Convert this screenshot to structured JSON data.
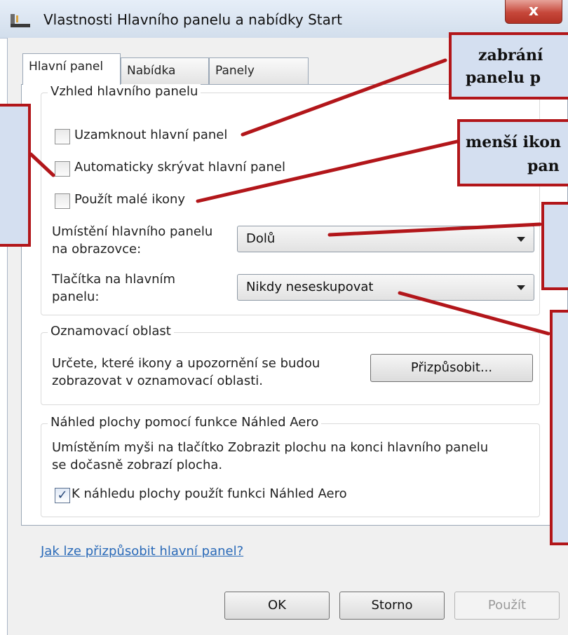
{
  "window": {
    "title": "Vlastnosti Hlavního panelu a nabídky Start",
    "close_label": "x"
  },
  "tabs": [
    {
      "label": "Hlavní panel"
    },
    {
      "label": "Nabídka Start"
    },
    {
      "label": "Panely nástrojů"
    }
  ],
  "appearance": {
    "legend": "Vzhled hlavního panelu",
    "lock_label": "Uzamknout hlavní panel",
    "lock_checked": false,
    "autohide_label": "Automaticky skrývat hlavní panel",
    "autohide_checked": false,
    "small_icons_label": "Použít malé ikony",
    "small_icons_checked": false,
    "position_label_1": "Umístění hlavního panelu",
    "position_label_2": "na obrazovce:",
    "position_value": "Dolů",
    "buttons_label_1": "Tlačítka na hlavním",
    "buttons_label_2": "panelu:",
    "buttons_value": "Nikdy neseskupovat"
  },
  "notification": {
    "legend": "Oznamovací oblast",
    "text_1": "Určete, které ikony a upozornění se budou",
    "text_2": "zobrazovat v oznamovací oblasti.",
    "customize_label": "Přizpůsobit..."
  },
  "aero": {
    "legend": "Náhled plochy pomocí funkce Náhled Aero",
    "text_1": "Umístěním myši na tlačítko Zobrazit plochu na konci hlavního panelu",
    "text_2": "se dočasně zobrazí plocha.",
    "checkbox_label": "K náhledu plochy použít funkci Náhled Aero",
    "checkbox_checked": true,
    "check_glyph": "✓"
  },
  "help_link": "Jak lze přizpůsobit hlavní panel?",
  "buttons": {
    "ok": "OK",
    "cancel": "Storno",
    "apply": "Použít"
  },
  "callouts": {
    "top_1": "zabrání",
    "top_2": "panelu p",
    "second_1": "menší ikon",
    "second_2": "pan"
  },
  "colors": {
    "callout_border": "#b2161a",
    "callout_fill": "#d4dff0",
    "link": "#2a6ab8",
    "close_button": "#c6473a"
  }
}
